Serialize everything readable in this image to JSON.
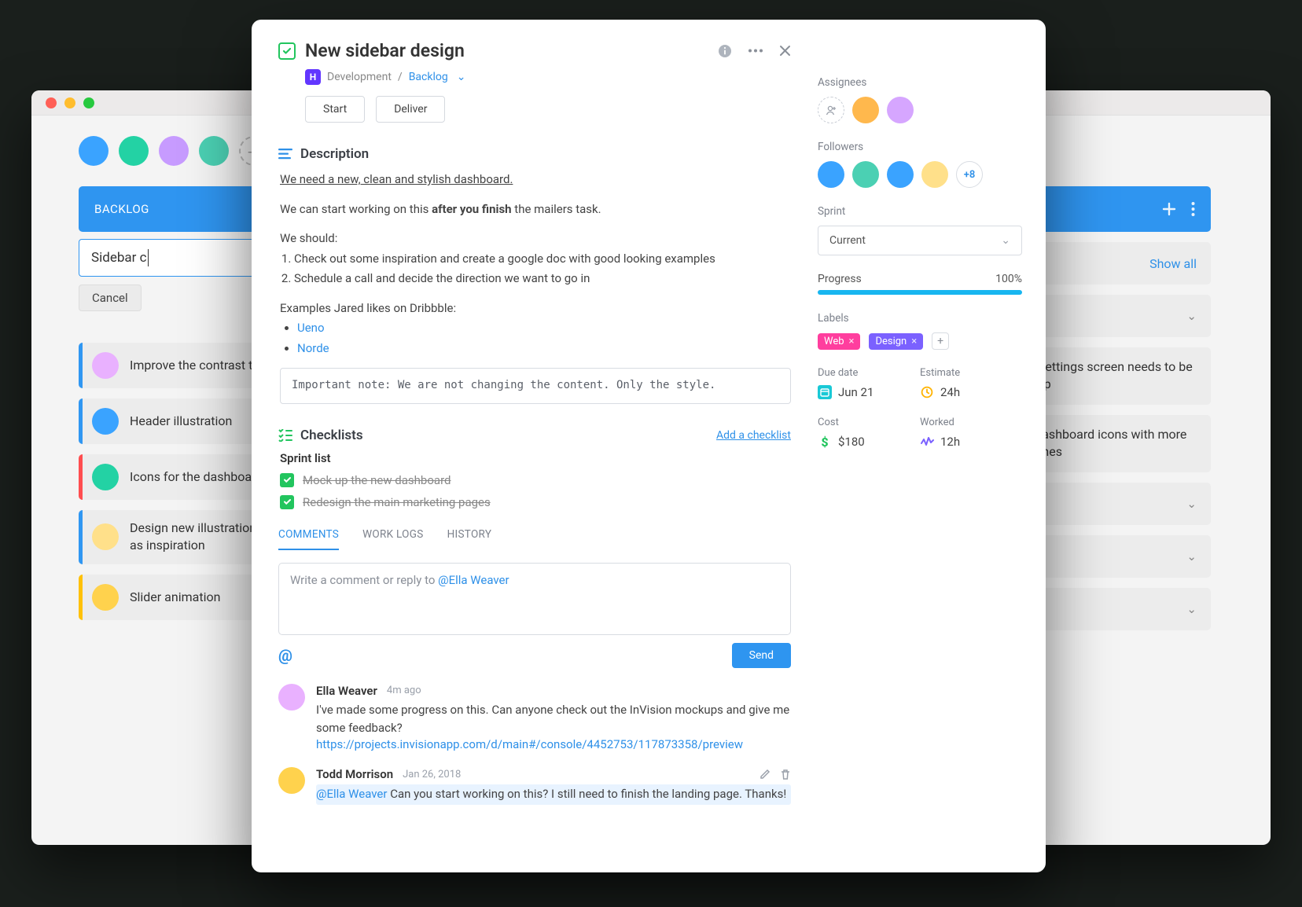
{
  "backlog": {
    "header": "BACKLOG",
    "new_task_text": "Sidebar c",
    "cancel": "Cancel",
    "cards": [
      {
        "stripe": "s-blue",
        "text": "Improve the contrast to make Jared happy :D"
      },
      {
        "stripe": "s-blue",
        "text": "Header illustration"
      },
      {
        "stripe": "s-red",
        "text": "Icons for the dashboard"
      },
      {
        "stripe": "s-blue",
        "text": "Design new illustrations for app onboarding screens. Use Slack as inspiration"
      },
      {
        "stripe": "s-yel",
        "text": "Slider animation"
      }
    ]
  },
  "col2": {
    "show_all": "Show all",
    "task1": "Account settings screen needs to be mocked up",
    "task2": "Change dashboard icons with more colorful ones"
  },
  "modal": {
    "title": "New sidebar design",
    "project_tag": "H",
    "project_name": "Development",
    "project_state": "Backlog",
    "buttons": {
      "start": "Start",
      "deliver": "Deliver"
    },
    "description": {
      "heading": "Description",
      "line1": "We need a new, clean and stylish dashboard.",
      "line2_a": "We can start working on this ",
      "line2_b": "after you finish",
      "line2_c": " the mailers task.",
      "should": "We should:",
      "ol1": "Check out some inspiration and create a google doc with good looking examples",
      "ol2": "Schedule a call and decide the direction we want to go in",
      "ex": "Examples Jared likes on Dribbble:",
      "link1": "Ueno",
      "link2": "Norde",
      "note": "Important note: We are not changing the content. Only the style."
    },
    "checklists": {
      "heading": "Checklists",
      "add": "Add a checklist",
      "list_name": "Sprint list",
      "items": [
        "Mock up the new dashboard",
        "Redesign the main marketing pages"
      ]
    },
    "tabs": {
      "comments": "COMMENTS",
      "worklogs": "WORK LOGS",
      "history": "HISTORY"
    },
    "comment_placeholder_a": "Write a comment or reply to ",
    "comment_placeholder_b": "@Ella Weaver",
    "send": "Send",
    "comments": [
      {
        "name": "Ella Weaver",
        "time": "4m ago",
        "text": "I've made some progress on this. Can anyone check out the InVision mockups and give me some feedback?",
        "link": "https://projects.invisionapp.com/d/main#/console/4452753/117873358/preview"
      },
      {
        "name": "Todd Morrison",
        "time": "Jan 26, 2018",
        "mention": "@Ella Weaver",
        "text": " Can you start working on this? I still need to finish the landing page. Thanks!"
      }
    ]
  },
  "side": {
    "assignees": "Assignees",
    "followers": "Followers",
    "followers_more": "+8",
    "sprint_lbl": "Sprint",
    "sprint_val": "Current",
    "progress_lbl": "Progress",
    "progress_val": "100%",
    "labels_lbl": "Labels",
    "labels": [
      {
        "name": "Web",
        "cls": "p-pink"
      },
      {
        "name": "Design",
        "cls": "p-purple"
      }
    ],
    "meta": {
      "due_lbl": "Due date",
      "due_val": "Jun 21",
      "est_lbl": "Estimate",
      "est_val": "24h",
      "cost_lbl": "Cost",
      "cost_val": "$180",
      "work_lbl": "Worked",
      "work_val": "12h"
    }
  }
}
